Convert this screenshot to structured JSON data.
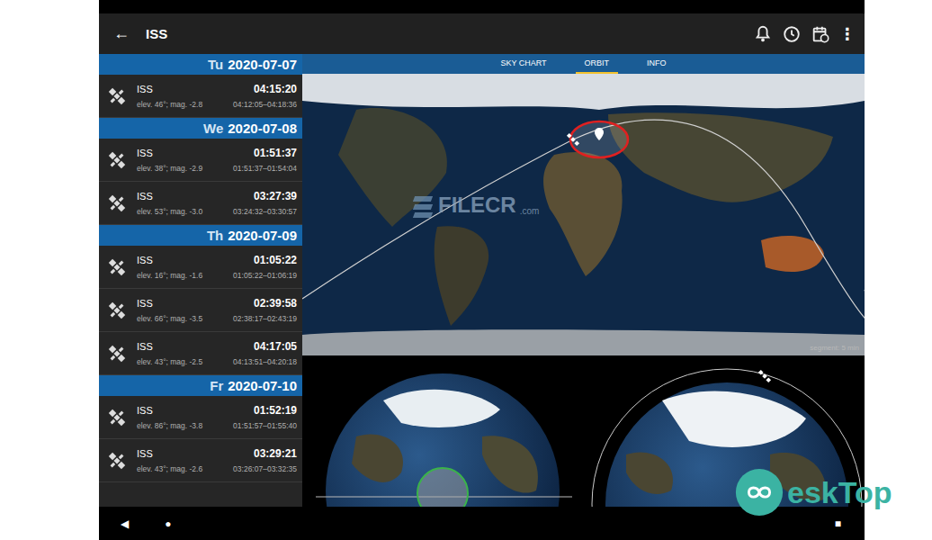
{
  "app_bar": {
    "back": "←",
    "title": "ISS",
    "more": "⋮"
  },
  "days": [
    {
      "weekday": "Tu",
      "date": "2020-07-07",
      "passes": [
        {
          "name": "ISS",
          "time": "04:15:20",
          "details": "elev. 46°; mag. -2.8",
          "window": "04:12:05–04:18:36"
        }
      ]
    },
    {
      "weekday": "We",
      "date": "2020-07-08",
      "passes": [
        {
          "name": "ISS",
          "time": "01:51:37",
          "details": "elev. 38°; mag. -2.9",
          "window": "01:51:37–01:54:04"
        },
        {
          "name": "ISS",
          "time": "03:27:39",
          "details": "elev. 53°; mag. -3.0",
          "window": "03:24:32–03:30:57"
        }
      ]
    },
    {
      "weekday": "Th",
      "date": "2020-07-09",
      "passes": [
        {
          "name": "ISS",
          "time": "01:05:22",
          "details": "elev. 16°; mag. -1.6",
          "window": "01:05:22–01:06:19"
        },
        {
          "name": "ISS",
          "time": "02:39:58",
          "details": "elev. 66°; mag. -3.5",
          "window": "02:38:17–02:43:19"
        },
        {
          "name": "ISS",
          "time": "04:17:05",
          "details": "elev. 43°; mag. -2.5",
          "window": "04:13:51–04:20:18"
        }
      ]
    },
    {
      "weekday": "Fr",
      "date": "2020-07-10",
      "passes": [
        {
          "name": "ISS",
          "time": "01:52:19",
          "details": "elev. 86°; mag. -3.8",
          "window": "01:51:57–01:55:40"
        },
        {
          "name": "ISS",
          "time": "03:29:21",
          "details": "elev. 43°; mag. -2.6",
          "window": "03:26:07–03:32:35"
        }
      ]
    }
  ],
  "tabs": [
    {
      "label": "SKY CHART",
      "selected": false
    },
    {
      "label": "ORBIT",
      "selected": true
    },
    {
      "label": "INFO",
      "selected": false
    }
  ],
  "map": {
    "segment_label": "segment: 5 min"
  },
  "nav_bar": {
    "back": "◀",
    "home": "●",
    "recents": "■"
  },
  "watermarks": {
    "filecr": "FILECR",
    "filecr_suffix": ".com",
    "desktop": "eskTop"
  }
}
